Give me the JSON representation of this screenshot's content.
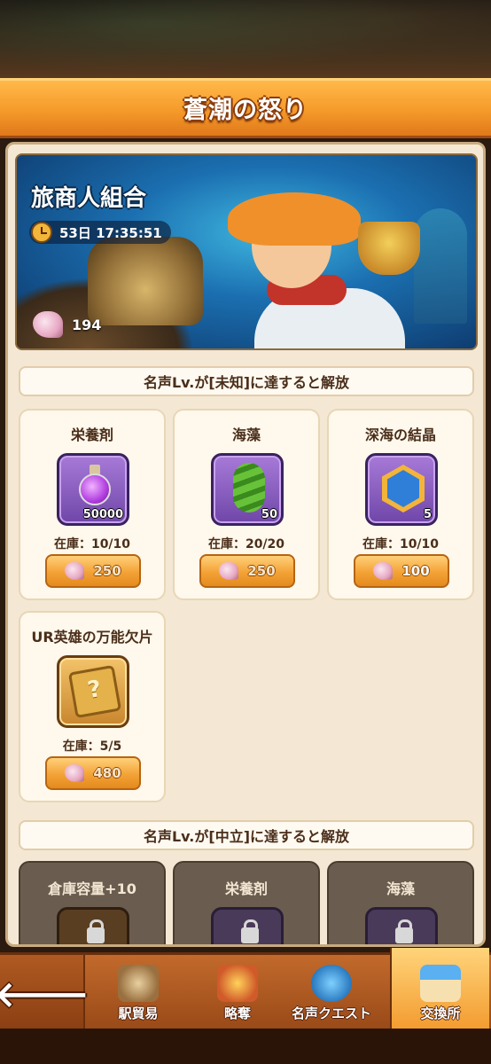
{
  "header": {
    "title": "蒼潮の怒り"
  },
  "banner": {
    "title": "旅商人組合",
    "timer": "53日 17:35:51",
    "currency_count": "194"
  },
  "sections": [
    {
      "unlock_text": "名声Lv.が[未知]に達すると解放",
      "items": [
        {
          "name": "栄養剤",
          "qty": "50000",
          "stock": "在庫：10/10",
          "price": "250",
          "icon": "potion-icon"
        },
        {
          "name": "海藻",
          "qty": "50",
          "stock": "在庫：20/20",
          "price": "250",
          "icon": "seaweed-icon"
        },
        {
          "name": "深海の結晶",
          "qty": "5",
          "stock": "在庫：10/10",
          "price": "100",
          "icon": "trident-crystal-icon"
        },
        {
          "name": "UR英雄の万能欠片",
          "qty": "",
          "stock": "在庫：5/5",
          "price": "480",
          "icon": "hero-fragment-icon"
        }
      ]
    },
    {
      "unlock_text": "名声Lv.が[中立]に達すると解放",
      "items": [
        {
          "name": "倉庫容量+10",
          "icon": "storage-crate-icon"
        },
        {
          "name": "栄養剤",
          "icon": "potion-icon"
        },
        {
          "name": "海藻",
          "icon": "seaweed-icon"
        }
      ]
    }
  ],
  "bottom_nav": {
    "back": "🡐",
    "items": [
      {
        "label": "駅貿易",
        "icon": "trade-ship-icon"
      },
      {
        "label": "略奪",
        "icon": "plunder-icon"
      },
      {
        "label": "名声クエスト",
        "icon": "reputation-quest-icon"
      },
      {
        "label": "交換所",
        "icon": "exchange-shop-icon",
        "active": true
      }
    ]
  },
  "colors": {
    "header_orange": "#f59a2a",
    "panel_bg": "#f4e8d4",
    "button_orange": "#f3a236",
    "slot_purple": "#6f46a8"
  }
}
